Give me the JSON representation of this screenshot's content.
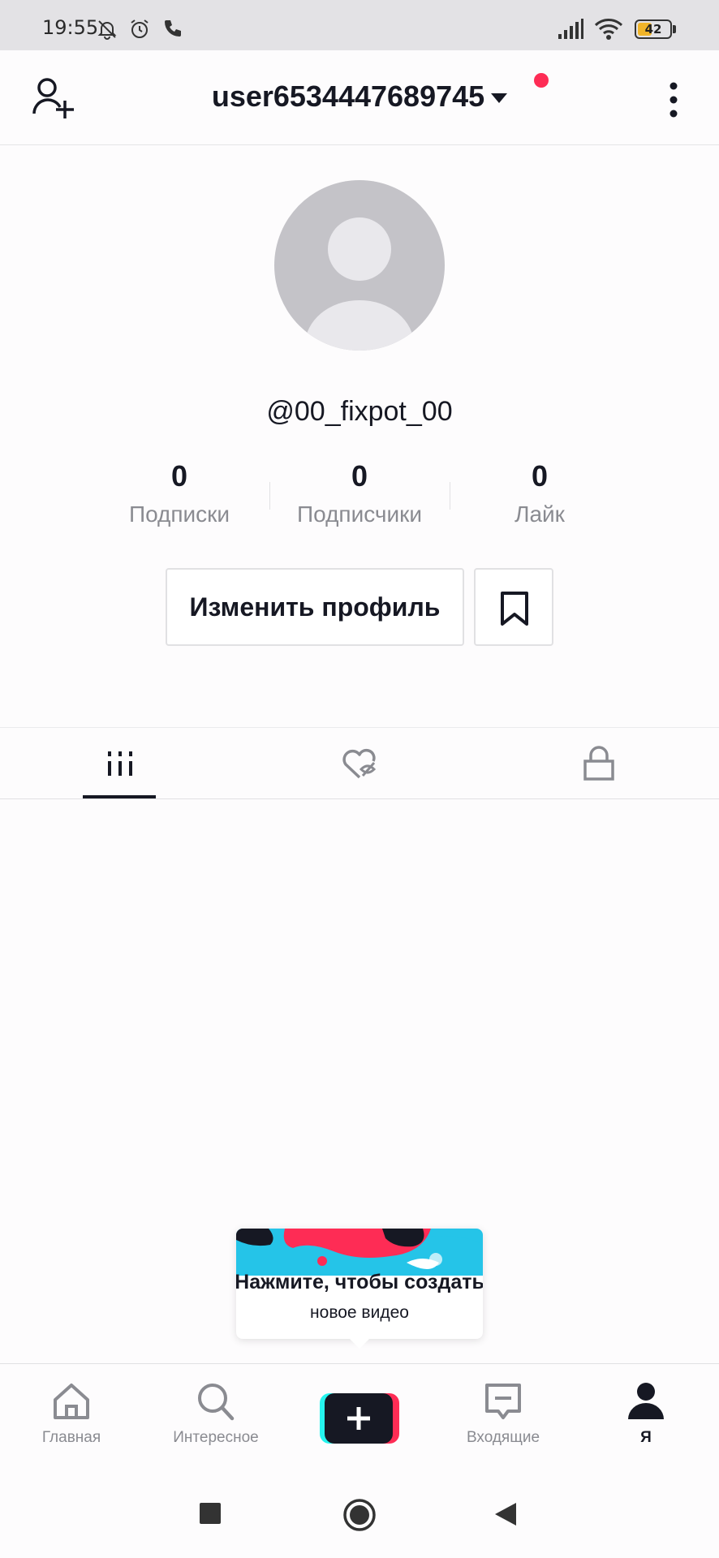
{
  "status_bar": {
    "time": "19:55",
    "icons": [
      "mute-bell-icon",
      "alarm-icon",
      "phone-icon",
      "signal-icon",
      "wifi-icon"
    ],
    "battery": "42"
  },
  "header": {
    "username": "user6534447689745",
    "add_friend_icon": "person-plus-icon",
    "menu_icon": "three-dots-vertical-icon",
    "notification_dot_color": "#fe2c55"
  },
  "profile": {
    "handle": "@00_fixpot_00",
    "stats": [
      {
        "value": "0",
        "label": "Подписки"
      },
      {
        "value": "0",
        "label": "Подписчики"
      },
      {
        "value": "0",
        "label": "Лайк"
      }
    ],
    "edit_button": "Изменить профиль",
    "bookmark_icon": "bookmark-icon"
  },
  "tabs": [
    {
      "icon": "grid-videos-icon",
      "active": true
    },
    {
      "icon": "liked-hidden-icon",
      "active": false
    },
    {
      "icon": "lock-icon",
      "active": false
    }
  ],
  "tooltip": {
    "title": "Нажмите, чтобы создать",
    "subtitle": "новое видео"
  },
  "bottom_nav": [
    {
      "label": "Главная",
      "icon": "home-icon"
    },
    {
      "label": "Интересное",
      "icon": "search-icon"
    },
    {
      "label": "",
      "icon": "plus-icon"
    },
    {
      "label": "Входящие",
      "icon": "inbox-icon"
    },
    {
      "label": "Я",
      "icon": "profile-icon",
      "active": true
    }
  ],
  "colors": {
    "accent_red": "#fe2c55",
    "accent_cyan": "#25f4ee",
    "text_primary": "#161823",
    "text_secondary": "#8a8b91"
  }
}
